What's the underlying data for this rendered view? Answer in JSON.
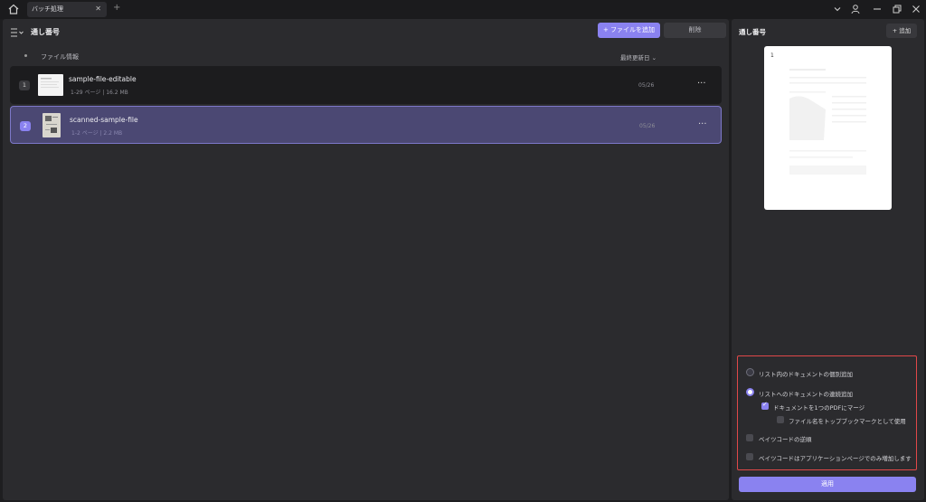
{
  "titlebar": {
    "tab_label": "バッチ処理",
    "tab_close": "✕",
    "new_tab": "+"
  },
  "toolbar": {
    "title": "通し番号",
    "add_file_label": "ファイルを追加",
    "add_file_icon": "+",
    "delete_label": "削除"
  },
  "list": {
    "col_file": "ファイル情報",
    "col_date": "最終更新日 ⌄",
    "rows": [
      {
        "num": "1",
        "name": "sample-file-editable",
        "meta": "1-29 ページ  |  16.2 MB",
        "date": "05/26",
        "more": "···"
      },
      {
        "num": "2",
        "name": "scanned-sample-file",
        "meta": "1-2 ページ  |  2.2 MB",
        "date": "05/26",
        "more": "···"
      }
    ]
  },
  "right_panel": {
    "title": "通し番号",
    "add_label": "+  追加",
    "preview_page_number": "1",
    "options": {
      "radio_individual": "リスト内のドキュメントの個別追加",
      "radio_continuous": "リストへのドキュメントの連続追加",
      "check_merge": "ドキュメントを1つのPDFにマージ",
      "check_bookmark": "ファイル名をトップブックマークとして使用",
      "check_reverse": "ベイツコードの逆順",
      "check_app_pages": "ベイツコードはアプリケーションページでのみ増加します"
    },
    "apply_label": "適用"
  },
  "colors": {
    "accent": "#8a82f0",
    "highlight_border": "#e04848",
    "selected_row": "#4b4873"
  }
}
